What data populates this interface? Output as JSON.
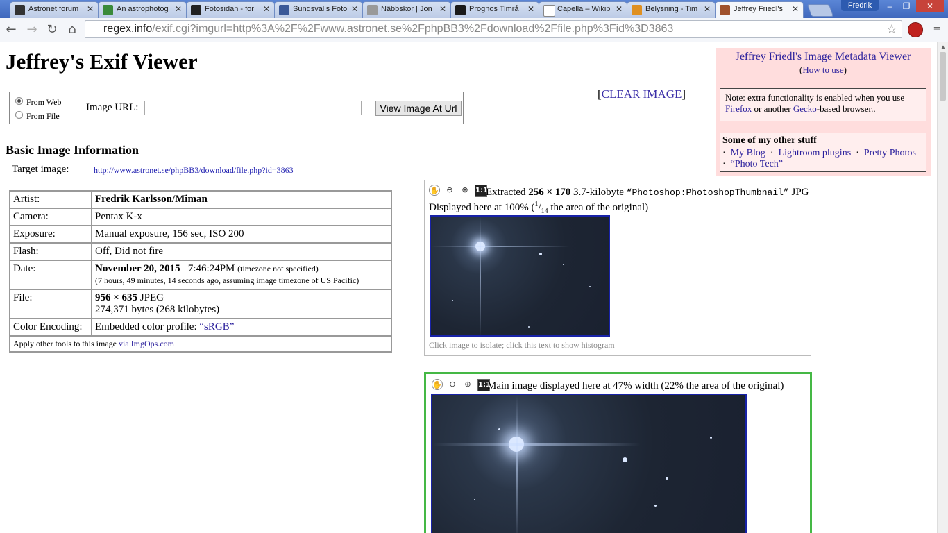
{
  "browser": {
    "tabs": [
      {
        "title": "Astronet forum",
        "color": "#333"
      },
      {
        "title": "An astrophotog",
        "color": "#3a8a3a"
      },
      {
        "title": "Fotosidan - for",
        "color": "#222"
      },
      {
        "title": "Sundsvalls Foto",
        "color": "#3b5998"
      },
      {
        "title": "Näbbskor | Jon",
        "color": "#888"
      },
      {
        "title": "Prognos Timrå",
        "color": "#1a1a1a"
      },
      {
        "title": "Capella – Wikip",
        "color": "#fff"
      },
      {
        "title": "Belysning - Tim",
        "color": "#e09020"
      },
      {
        "title": "Jeffrey Friedl's",
        "color": "#a0522d"
      }
    ],
    "user": "Fredrik",
    "url_host": "regex.info",
    "url_path": "/exif.cgi?imgurl=http%3A%2F%2Fwww.astronet.se%2FphpBB3%2Fdownload%2Ffile.php%3Fid%3D3863"
  },
  "page": {
    "title": "Jeffrey's Exif Viewer",
    "form": {
      "from_web": "From Web",
      "from_file": "From File",
      "url_label": "Image URL:",
      "url_value": "",
      "button": "View Image At Url"
    },
    "clear_image": "CLEAR IMAGE",
    "side": {
      "title": "Jeffrey Friedl's Image Metadata Viewer",
      "how_to_use": "How to use",
      "note_prefix": "Note: extra functionality is enabled when you use ",
      "firefox": "Firefox",
      "note_mid": " or another ",
      "gecko": "Gecko",
      "note_suffix": "-based browser..",
      "other_heading": "Some of my other stuff",
      "links": [
        "My Blog",
        "Lightroom plugins",
        "Pretty Photos",
        "“Photo Tech”"
      ]
    },
    "basic_heading": "Basic Image Information",
    "target_label": "Target image:",
    "target_url": "http://www.astronet.se/phpBB3/download/file.php?id=3863",
    "info": {
      "artist_k": "Artist:",
      "artist_v": "Fredrik Karlsson/Miman",
      "camera_k": "Camera:",
      "camera_v": "Pentax K-x",
      "exposure_k": "Exposure:",
      "exposure_v": "Manual exposure, 156 sec, ISO 200",
      "flash_k": "Flash:",
      "flash_v": "Off, Did not fire",
      "date_k": "Date:",
      "date_v": "November 20, 2015",
      "date_time": "7:46:24PM",
      "date_tz": "(timezone not specified)",
      "date_ago": "(7 hours, 49 minutes, 14 seconds ago, assuming image timezone of US Pacific)",
      "file_k": "File:",
      "file_dims": "956 × 635",
      "file_type": "JPEG",
      "file_bytes": "274,371 bytes (268 kilobytes)",
      "color_k": "Color Encoding:",
      "color_v": "Embedded color profile: ",
      "color_link": "“sRGB”",
      "tools": "Apply other tools to this image ",
      "tools_link": "via ImgOps.com"
    },
    "thumb": {
      "extracted": "Extracted ",
      "dims": "256 × 170",
      "size": " 3.7-kilobyte ",
      "tag": "“Photoshop:PhotoshopThumbnail”",
      "jpg": " JPG",
      "displayed": "Displayed here at 100% (",
      "frac_num": "1",
      "frac_den": "14",
      "displayed_end": " the area of the original)",
      "hint": "Click image to isolate; click this text to show histogram"
    },
    "main": {
      "text": "Main image displayed here at 47% width (22% the area of the original)"
    },
    "icon_one": "1:1"
  }
}
